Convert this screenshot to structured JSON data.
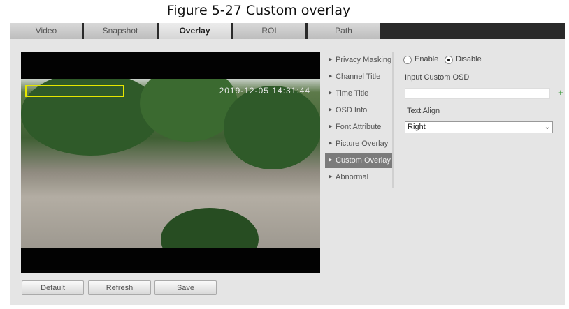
{
  "caption": "Figure 5-27 Custom overlay",
  "tabs": [
    "Video",
    "Snapshot",
    "Overlay",
    "ROI",
    "Path"
  ],
  "active_tab": "Overlay",
  "video": {
    "timestamp": "2019-12-05 14:31:44"
  },
  "buttons": {
    "default": "Default",
    "refresh": "Refresh",
    "save": "Save"
  },
  "menu": [
    "Privacy Masking",
    "Channel Title",
    "Time Title",
    "OSD Info",
    "Font Attribute",
    "Picture Overlay",
    "Custom Overlay",
    "Abnormal"
  ],
  "active_menu": "Custom Overlay",
  "form": {
    "enable": "Enable",
    "disable": "Disable",
    "selected": "Disable",
    "osd_label": "Input Custom OSD",
    "osd_value": "",
    "align_label": "Text Align",
    "align_value": "Right",
    "plus": "+"
  }
}
